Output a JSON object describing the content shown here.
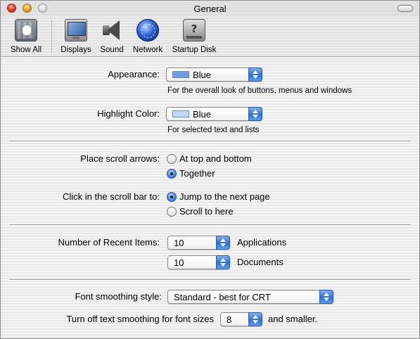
{
  "window": {
    "title": "General"
  },
  "toolbar": {
    "items": [
      {
        "label": "Show All",
        "icon": "apple-icon"
      },
      {
        "label": "Displays",
        "icon": "display-icon"
      },
      {
        "label": "Sound",
        "icon": "speaker-icon"
      },
      {
        "label": "Network",
        "icon": "globe-icon"
      },
      {
        "label": "Startup Disk",
        "icon": "hard-disk-icon"
      }
    ]
  },
  "appearance": {
    "label": "Appearance:",
    "value": "Blue",
    "swatch_color": "#6f9be0",
    "hint": "For the overall look of buttons, menus and windows"
  },
  "highlight": {
    "label": "Highlight Color:",
    "value": "Blue",
    "swatch_color": "#c4d7f5",
    "hint": "For selected text and lists"
  },
  "scroll_arrows": {
    "label": "Place scroll arrows:",
    "options": [
      "At top and bottom",
      "Together"
    ],
    "selected": "Together"
  },
  "scroll_bar": {
    "label": "Click in the scroll bar to:",
    "options": [
      "Jump to the next page",
      "Scroll to here"
    ],
    "selected": "Jump to the next page"
  },
  "recent_items": {
    "label": "Number of Recent Items:",
    "applications_value": "10",
    "applications_label": "Applications",
    "documents_value": "10",
    "documents_label": "Documents"
  },
  "font_smoothing": {
    "label": "Font smoothing style:",
    "value": "Standard - best for CRT"
  },
  "text_smoothing": {
    "label": "Turn off text smoothing for font sizes",
    "value": "8",
    "suffix": "and smaller."
  },
  "colors": {
    "accent": "#2d6fd9"
  }
}
